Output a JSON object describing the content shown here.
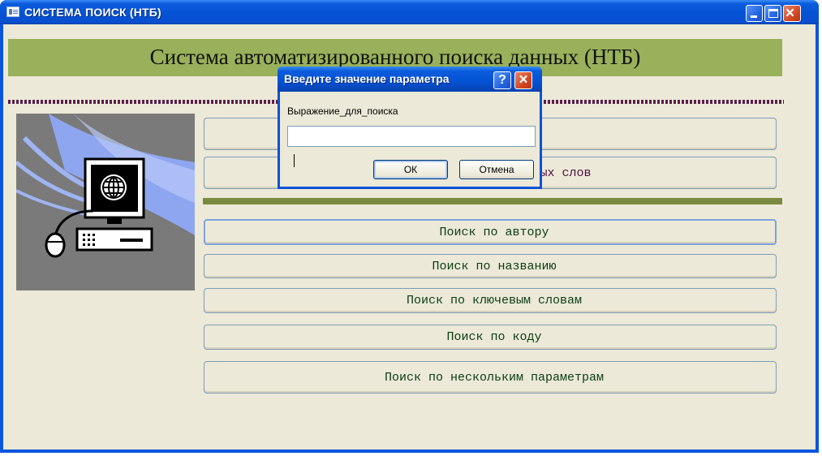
{
  "window": {
    "title": "СИСТЕМА ПОИСК (НТБ)",
    "buttons": {
      "minimize": "minimize",
      "maximize": "maximize",
      "close": "×"
    }
  },
  "banner": {
    "title": "Система автоматизированного поиска данных (НТБ)"
  },
  "buttons_top": [
    {
      "label": ""
    },
    {
      "label": "ючевых слов"
    }
  ],
  "buttons_main": [
    {
      "label": "Поиск по автору"
    },
    {
      "label": "Поиск по названию"
    },
    {
      "label": "Поиск по ключевым словам"
    },
    {
      "label": "Поиск по коду"
    },
    {
      "label": "Поиск по нескольким параметрам"
    }
  ],
  "dialog": {
    "title": "Введите значение параметра",
    "help": "?",
    "close": "×",
    "label": "Выражение_для_поиска",
    "input_value": "",
    "ok": "ОК",
    "cancel": "Отмена"
  },
  "colors": {
    "titlebar": "#0452d4",
    "banner": "#99b15a",
    "button_text": "#0b3d12",
    "client_bg": "#ece9d8"
  },
  "icons": [
    "form-icon",
    "computer-icon",
    "globe-icon",
    "mouse-icon",
    "keyboard-icon"
  ]
}
